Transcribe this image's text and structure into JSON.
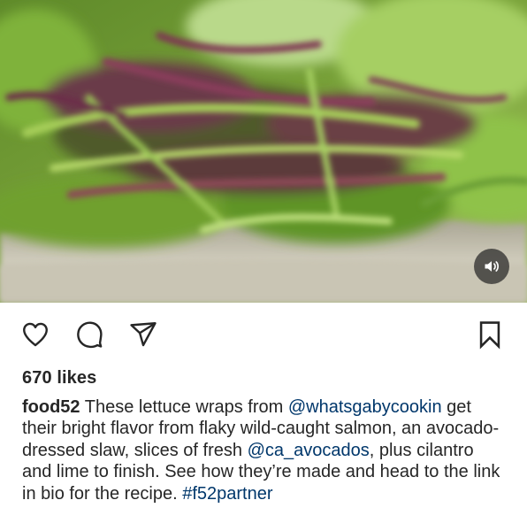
{
  "post": {
    "media": {
      "type": "video",
      "subject": "lettuce wrap with slaw close-up",
      "sound_icon": "speaker-volume-icon"
    },
    "actions": {
      "like_icon": "heart-icon",
      "comment_icon": "comment-bubble-icon",
      "share_icon": "paper-plane-icon",
      "save_icon": "bookmark-icon"
    },
    "likes": "670 likes",
    "caption": {
      "username": "food52",
      "segments": [
        " These lettuce wraps from ",
        "@whatsgabycookin",
        " get their bright flavor from flaky wild-caught salmon, an avocado-dressed slaw, slices of fresh ",
        "@ca_avocados",
        ", plus cilantro and lime to finish. See how they’re made and head to the link in bio for the recipe. ",
        "#f52partner"
      ]
    }
  },
  "colors": {
    "text": "#262626",
    "link": "#00376b",
    "background": "#ffffff",
    "overlay_button": "#262626"
  }
}
